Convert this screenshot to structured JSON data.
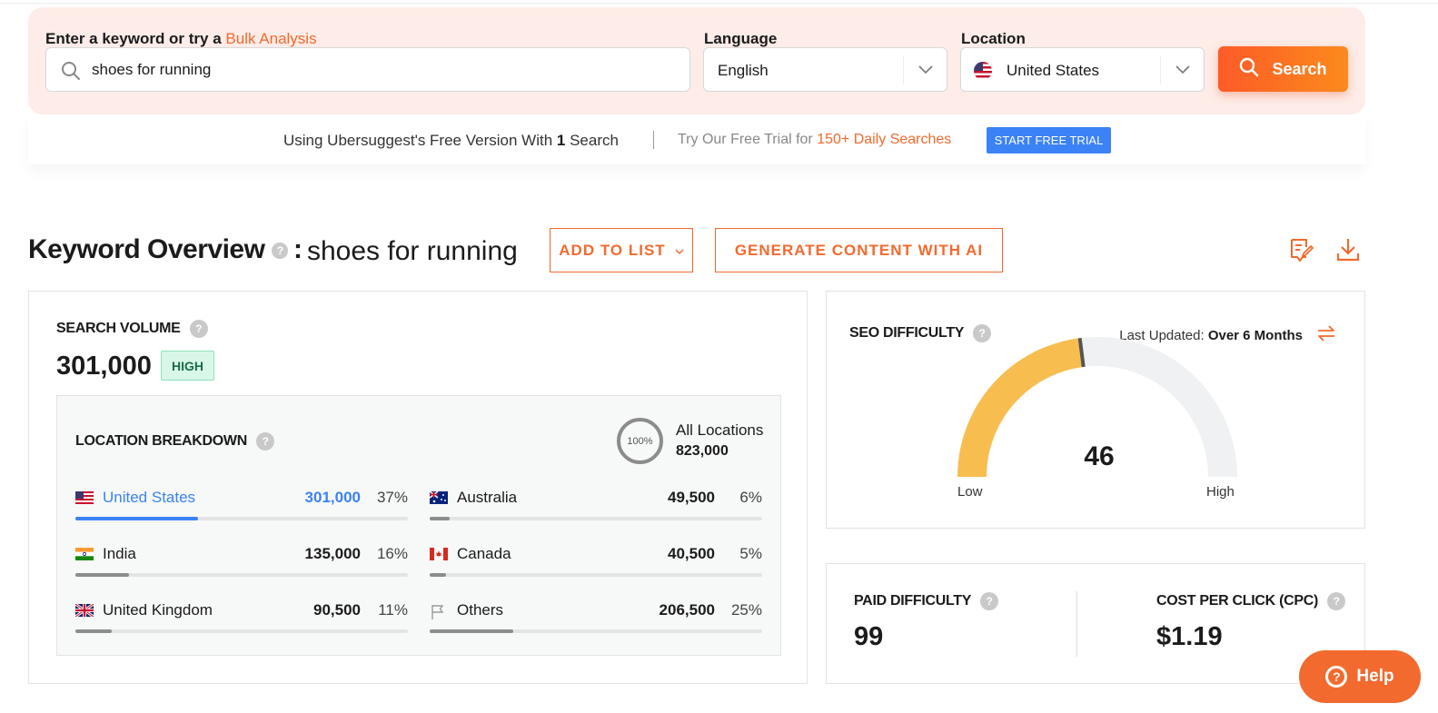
{
  "search": {
    "label_prefix": "Enter a keyword or try a",
    "bulk_link": "Bulk Analysis",
    "keyword_value": "shoes for running",
    "language_label": "Language",
    "language_value": "English",
    "location_label": "Location",
    "location_value": "United States",
    "search_button": "Search"
  },
  "free_bar": {
    "text_prefix": "Using Ubersuggest's Free Version With",
    "count": "1",
    "text_suffix": "Search",
    "trial_prefix": "Try Our Free Trial for",
    "trial_highlight": "150+ Daily Searches",
    "trial_button": "START FREE TRIAL"
  },
  "overview": {
    "title": "Keyword Overview",
    "help": "?",
    "colon": ":",
    "query": "shoes for running",
    "add_to_list": "ADD TO LIST",
    "generate_ai": "GENERATE CONTENT WITH AI"
  },
  "search_volume": {
    "title": "SEARCH VOLUME",
    "value": "301,000",
    "badge": "HIGH"
  },
  "location_breakdown": {
    "title": "LOCATION BREAKDOWN",
    "donut_label": "100%",
    "all_label": "All Locations",
    "all_value": "823,000",
    "items": [
      {
        "name": "United States",
        "value": "301,000",
        "pct": "37%",
        "fraction": 0.37
      },
      {
        "name": "Australia",
        "value": "49,500",
        "pct": "6%",
        "fraction": 0.06
      },
      {
        "name": "India",
        "value": "135,000",
        "pct": "16%",
        "fraction": 0.16
      },
      {
        "name": "Canada",
        "value": "40,500",
        "pct": "5%",
        "fraction": 0.05
      },
      {
        "name": "United Kingdom",
        "value": "90,500",
        "pct": "11%",
        "fraction": 0.11
      },
      {
        "name": "Others",
        "value": "206,500",
        "pct": "25%",
        "fraction": 0.25
      }
    ]
  },
  "seo_difficulty": {
    "title": "SEO DIFFICULTY",
    "last_updated_label": "Last Updated:",
    "last_updated_value": "Over 6 Months",
    "value": "46",
    "low": "Low",
    "high": "High",
    "gauge_color": "#f8bd4f"
  },
  "paid_difficulty": {
    "title": "PAID DIFFICULTY",
    "value": "99"
  },
  "cpc": {
    "title": "COST PER CLICK (CPC)",
    "value": "$1.19"
  },
  "help_button": "Help",
  "colors": {
    "accent": "#f26a2e",
    "blue": "#3b82f6"
  }
}
